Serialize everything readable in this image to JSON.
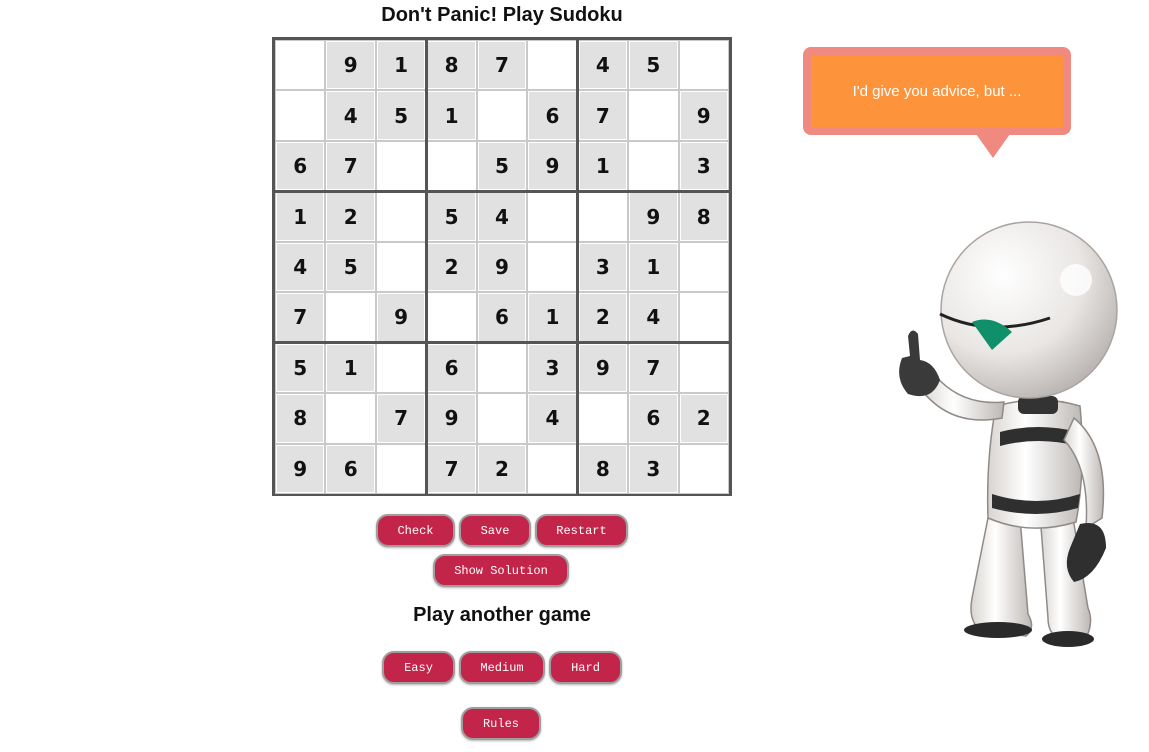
{
  "title": "Don't Panic! Play Sudoku",
  "board": [
    [
      0,
      9,
      1,
      8,
      7,
      0,
      4,
      5,
      0
    ],
    [
      0,
      4,
      5,
      1,
      0,
      6,
      7,
      0,
      9
    ],
    [
      6,
      7,
      0,
      0,
      5,
      9,
      1,
      0,
      3
    ],
    [
      1,
      2,
      0,
      5,
      4,
      0,
      0,
      9,
      8
    ],
    [
      4,
      5,
      0,
      2,
      9,
      0,
      3,
      1,
      0
    ],
    [
      7,
      0,
      9,
      0,
      6,
      1,
      2,
      4,
      0
    ],
    [
      5,
      1,
      0,
      6,
      0,
      3,
      9,
      7,
      0
    ],
    [
      8,
      0,
      7,
      9,
      0,
      4,
      0,
      6,
      2
    ],
    [
      9,
      6,
      0,
      7,
      2,
      0,
      8,
      3,
      0
    ]
  ],
  "buttons": {
    "check": "Check",
    "save": "Save",
    "restart": "Restart",
    "show_solution": "Show Solution"
  },
  "subtitle": "Play another game",
  "difficulty": {
    "easy": "Easy",
    "medium": "Medium",
    "hard": "Hard"
  },
  "rules": "Rules",
  "advice": "I'd give you advice, but ...",
  "colors": {
    "button": "#c2244a",
    "bubble_border": "#f08a80",
    "bubble_fill": "#fd943b",
    "given_cell": "#e1e1e1"
  }
}
